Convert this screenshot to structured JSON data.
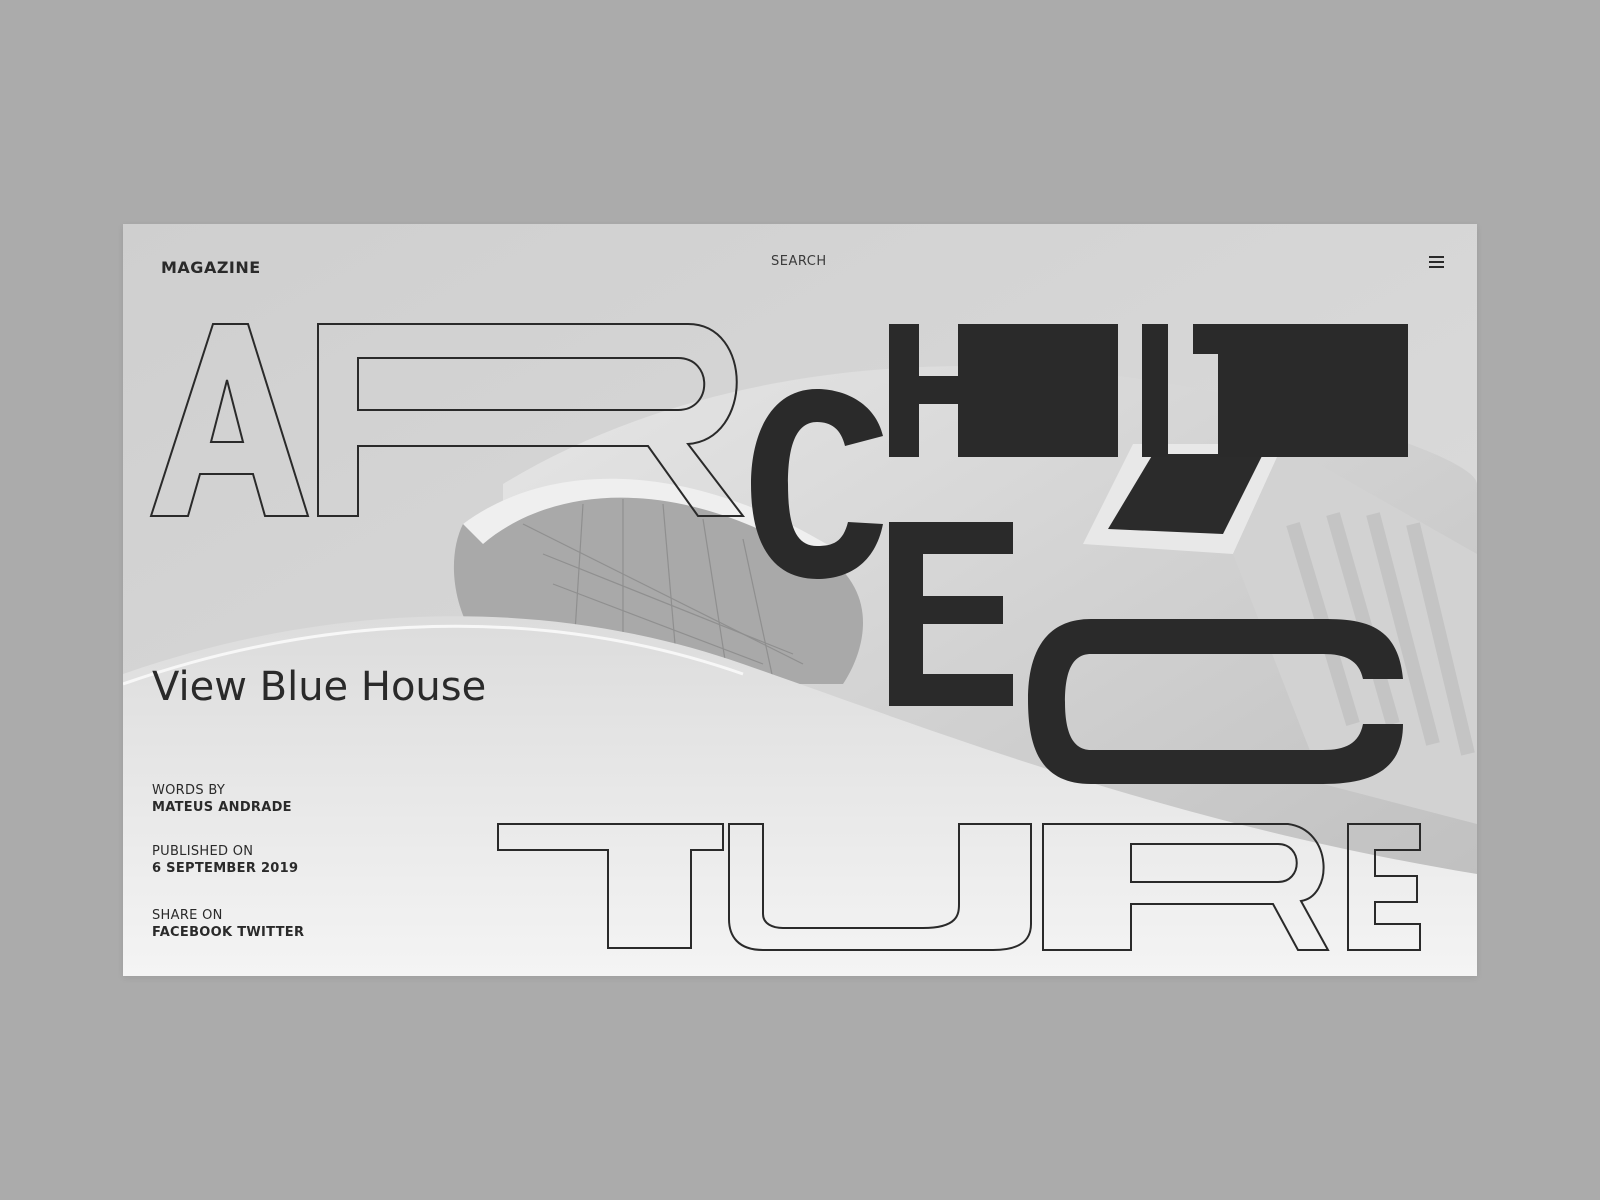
{
  "header": {
    "logo": "MAGAZINE",
    "search_label": "SEARCH",
    "menu_icon": "hamburger-menu-icon"
  },
  "hero": {
    "background_image": "black-and-white curved architecture photo",
    "title_word": "ARCHITECTURE",
    "headline": "View Blue House"
  },
  "meta": {
    "words_by_label": "WORDS BY",
    "author": "MATEUS ANDRADE",
    "published_label": "PUBLISHED ON",
    "published_date": "6 SEPTEMBER 2019",
    "share_label": "SHARE ON",
    "share_facebook": "FACEBOOK",
    "share_twitter": "TWITTER"
  },
  "colors": {
    "page_background": "#ababab",
    "ink": "#2a2a2a"
  }
}
